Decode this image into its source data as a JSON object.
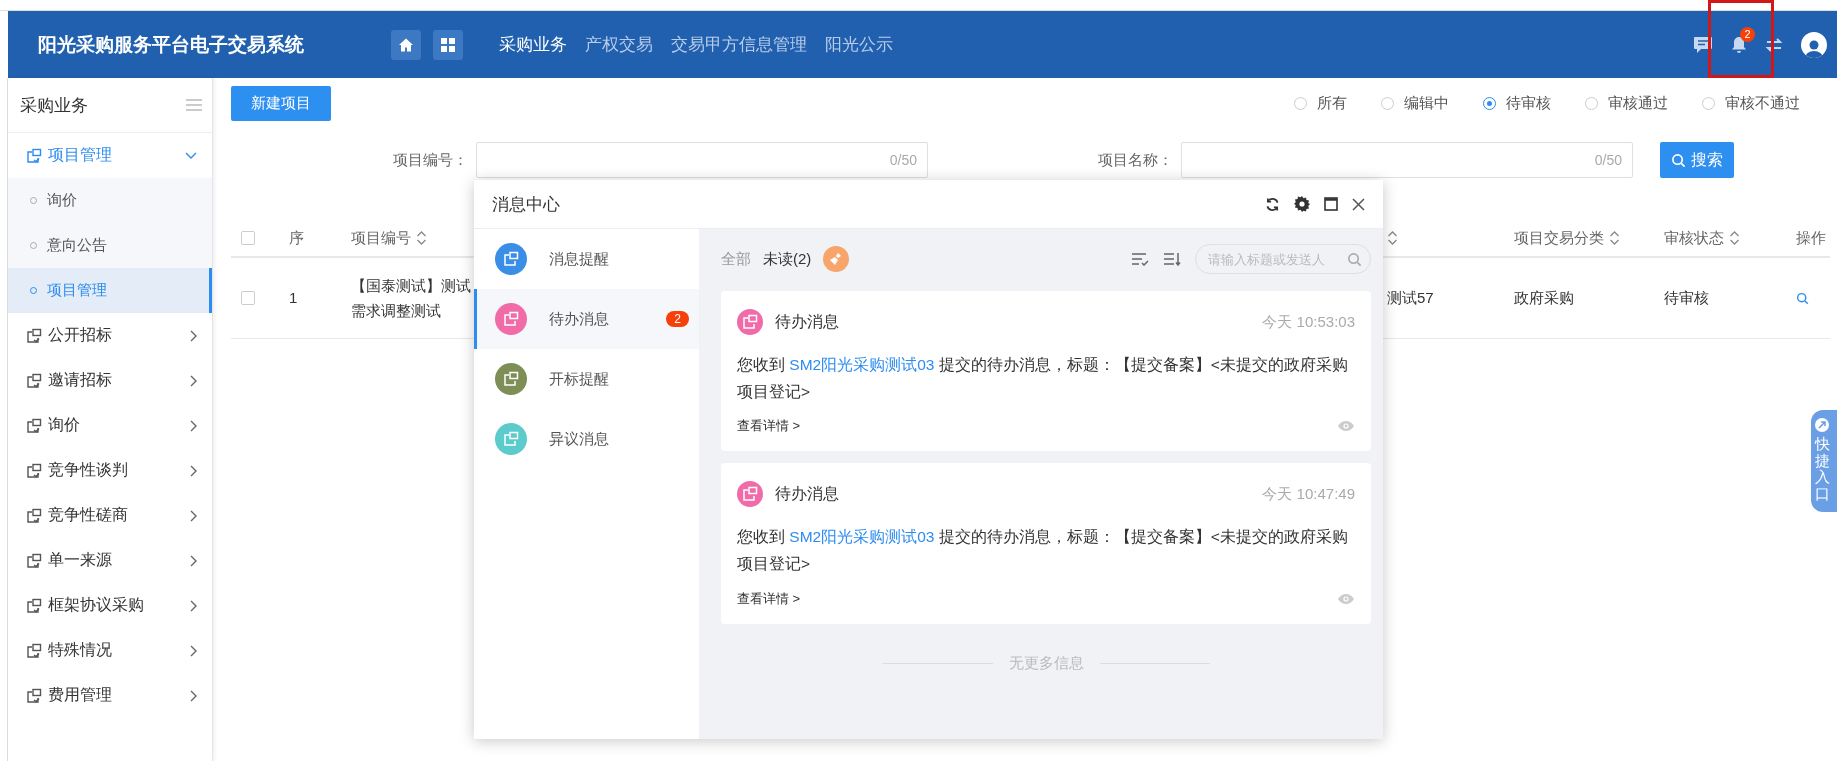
{
  "header": {
    "title": "阳光采购服务平台电子交易系统",
    "nav": [
      {
        "label": "采购业务",
        "selected": true
      },
      {
        "label": "产权交易",
        "selected": false
      },
      {
        "label": "交易甲方信息管理",
        "selected": false
      },
      {
        "label": "阳光公示",
        "selected": false
      }
    ],
    "notification_count": "2"
  },
  "sidebar": {
    "title": "采购业务",
    "items": [
      {
        "label": "项目管理",
        "expanded": true,
        "children": [
          {
            "label": "询价",
            "selected": false
          },
          {
            "label": "意向公告",
            "selected": false
          },
          {
            "label": "项目管理",
            "selected": true
          }
        ]
      },
      {
        "label": "公开招标",
        "expanded": false
      },
      {
        "label": "邀请招标",
        "expanded": false
      },
      {
        "label": "询价",
        "expanded": false
      },
      {
        "label": "竞争性谈判",
        "expanded": false
      },
      {
        "label": "竞争性磋商",
        "expanded": false
      },
      {
        "label": "单一来源",
        "expanded": false
      },
      {
        "label": "框架协议采购",
        "expanded": false
      },
      {
        "label": "特殊情况",
        "expanded": false
      },
      {
        "label": "费用管理",
        "expanded": false
      }
    ]
  },
  "toolbar": {
    "new_button": "新建项目",
    "status_filters": [
      {
        "label": "所有",
        "selected": false
      },
      {
        "label": "编辑中",
        "selected": false
      },
      {
        "label": "待审核",
        "selected": true
      },
      {
        "label": "审核通过",
        "selected": false
      },
      {
        "label": "审核不通过",
        "selected": false
      }
    ]
  },
  "search": {
    "fields": [
      {
        "label": "项目编号：",
        "counter": "0/50"
      },
      {
        "label": "项目名称：",
        "counter": "0/50"
      }
    ],
    "button": "搜索"
  },
  "table": {
    "columns": [
      {
        "kind": "checkbox",
        "checked": false
      },
      {
        "kind": "text",
        "label": "序",
        "sortable": false
      },
      {
        "kind": "text",
        "label": "项目编号",
        "sortable": true
      },
      {
        "kind": "covered",
        "sortable": true
      },
      {
        "kind": "text",
        "label": "项目交易分类",
        "sortable": true
      },
      {
        "kind": "text",
        "label": "审核状态",
        "sortable": true
      },
      {
        "kind": "text",
        "label": "操作",
        "sortable": false
      }
    ],
    "rows": [
      {
        "checked": false,
        "index": "1",
        "project_number": [
          "【国泰测试】测试",
          "需求调整测试"
        ],
        "column_4": "测试57",
        "category": "政府采购",
        "status": "待审核"
      }
    ]
  },
  "modal": {
    "title": "消息中心",
    "categories": [
      {
        "label": "消息提醒",
        "color": "#3a8ee6",
        "selected": false
      },
      {
        "label": "待办消息",
        "color": "#f06ba8",
        "selected": true,
        "badge": "2"
      },
      {
        "label": "开标提醒",
        "color": "#7d8f57",
        "selected": false
      },
      {
        "label": "异议消息",
        "color": "#5ccbcb",
        "selected": false
      }
    ],
    "filters": [
      {
        "label": "全部",
        "selected": false
      },
      {
        "label": "未读(2)",
        "selected": true
      }
    ],
    "search_placeholder": "请输入标题或发送人",
    "messages": [
      {
        "type": "待办消息",
        "color": "#f06ba8",
        "time": "今天 10:53:03",
        "text_before": "您收到 ",
        "sender": "SM2阳光采购测试03",
        "text_after": " 提交的待办消息，标题：【提交备案】<未提交的政府采购项目登记>",
        "details": "查看详情 >"
      },
      {
        "type": "待办消息",
        "color": "#f06ba8",
        "time": "今天 10:47:49",
        "text_before": "您收到 ",
        "sender": "SM2阳光采购测试03",
        "text_after": " 提交的待办消息，标题：【提交备案】<未提交的政府采购项目登记>",
        "details": "查看详情 >"
      }
    ],
    "end_note": "无更多信息"
  },
  "quick_entry": {
    "label": "快捷入口"
  }
}
